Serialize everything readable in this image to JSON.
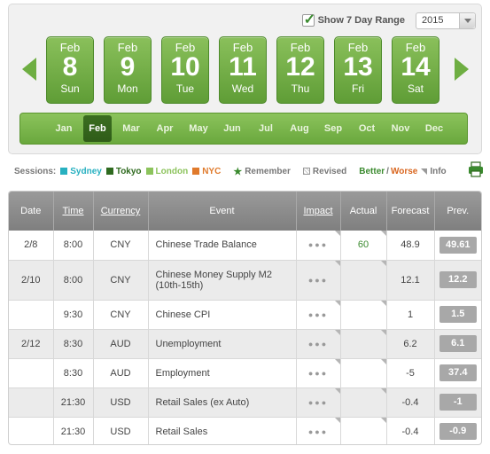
{
  "header": {
    "show_range_label": "Show 7 Day Range",
    "year": "2015"
  },
  "days": [
    {
      "month": "Feb",
      "day": "8",
      "weekday": "Sun"
    },
    {
      "month": "Feb",
      "day": "9",
      "weekday": "Mon"
    },
    {
      "month": "Feb",
      "day": "10",
      "weekday": "Tue"
    },
    {
      "month": "Feb",
      "day": "11",
      "weekday": "Wed"
    },
    {
      "month": "Feb",
      "day": "12",
      "weekday": "Thu"
    },
    {
      "month": "Feb",
      "day": "13",
      "weekday": "Fri"
    },
    {
      "month": "Feb",
      "day": "14",
      "weekday": "Sat"
    }
  ],
  "months": [
    "Jan",
    "Feb",
    "Mar",
    "Apr",
    "May",
    "Jun",
    "Jul",
    "Aug",
    "Sep",
    "Oct",
    "Nov",
    "Dec"
  ],
  "active_month": "Feb",
  "legend": {
    "sessions_label": "Sessions:",
    "sessions": [
      {
        "name": "Sydney",
        "color": "#27b0c0"
      },
      {
        "name": "Tokyo",
        "color": "#2f6a1f"
      },
      {
        "name": "London",
        "color": "#8cc35c"
      },
      {
        "name": "NYC",
        "color": "#e07a2c"
      }
    ],
    "remember": "Remember",
    "revised": "Revised",
    "better": "Better",
    "slash": "/",
    "worse": "Worse",
    "info": "Info"
  },
  "table": {
    "headers": {
      "date": "Date",
      "time": "Time",
      "currency": "Currency",
      "event": "Event",
      "impact": "Impact",
      "actual": "Actual",
      "forecast": "Forecast",
      "previous": "Prev."
    },
    "rows": [
      {
        "date": "2/8",
        "time": "8:00",
        "currency": "CNY",
        "event": "Chinese Trade Balance",
        "actual": "60",
        "forecast": "48.9",
        "previous": "49.61"
      },
      {
        "date": "2/10",
        "time": "8:00",
        "currency": "CNY",
        "event": "Chinese Money Supply M2 (10th-15th)",
        "actual": "",
        "forecast": "12.1",
        "previous": "12.2"
      },
      {
        "date": "",
        "time": "9:30",
        "currency": "CNY",
        "event": "Chinese CPI",
        "actual": "",
        "forecast": "1",
        "previous": "1.5"
      },
      {
        "date": "2/12",
        "time": "8:30",
        "currency": "AUD",
        "event": "Unemployment",
        "actual": "",
        "forecast": "6.2",
        "previous": "6.1"
      },
      {
        "date": "",
        "time": "8:30",
        "currency": "AUD",
        "event": "Employment",
        "actual": "",
        "forecast": "-5",
        "previous": "37.4"
      },
      {
        "date": "",
        "time": "21:30",
        "currency": "USD",
        "event": "Retail Sales (ex Auto)",
        "actual": "",
        "forecast": "-0.4",
        "previous": "-1"
      },
      {
        "date": "",
        "time": "21:30",
        "currency": "USD",
        "event": "Retail Sales",
        "actual": "",
        "forecast": "-0.4",
        "previous": "-0.9"
      }
    ],
    "impact_dots": "●●●"
  }
}
